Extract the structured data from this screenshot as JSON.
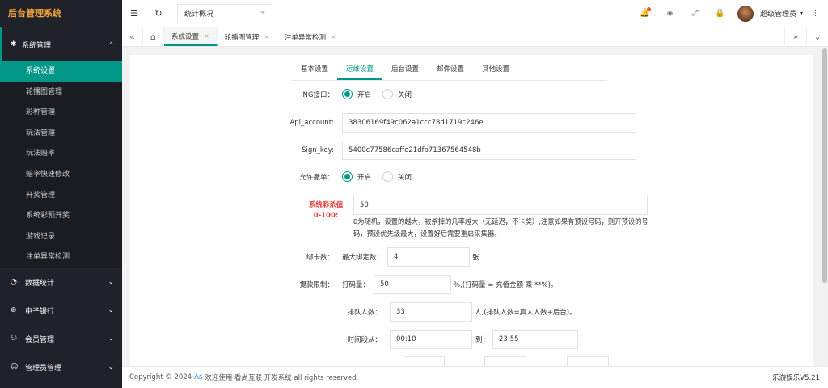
{
  "sidebar": {
    "logo": "后台管理系统",
    "section": "系统管理",
    "items": [
      "系统设置",
      "轮播图管理",
      "彩种管理",
      "玩法管理",
      "玩法赔率",
      "赔率快速修改",
      "开奖管理",
      "系统彩预开奖",
      "游戏记录",
      "注单异常检测"
    ],
    "groups": [
      "数据统计",
      "电子银行",
      "会员管理",
      "管理员管理"
    ]
  },
  "topbar": {
    "select_value": "统计概况",
    "user": "超级管理员"
  },
  "tabs": [
    "系统设置",
    "轮播图管理",
    "注单异常检测"
  ],
  "inner_tabs": [
    "基本设置",
    "运维设置",
    "后台设置",
    "邮件设置",
    "其他设置"
  ],
  "form": {
    "ng_label": "NG接口：",
    "radio_on": "开启",
    "radio_off": "关闭",
    "api_label": "Api_account:",
    "api_value": "38306169f49c062a1ccc78d1719c246e",
    "sign_label": "Sign_key:",
    "sign_value": "5400c77586caffe21dfb71367564548b",
    "cancel_label": "允许撤单：",
    "kill_label_1": "系统彩杀值",
    "kill_label_2": "0-100:",
    "kill_value": "50",
    "kill_help": "0为随机，设置的越大，被杀掉的几率越大（无延迟，不卡奖）,注意如果有预设号码，则开预设的号码，预设优先级最大，设置好后需要重启采集器。",
    "card_label": "绑卡数：",
    "card_sub": "最大绑定数：",
    "card_value": "4",
    "card_unit": "张",
    "withdraw_label": "提款限制：",
    "bet_label": "打码量：",
    "bet_value": "50",
    "bet_note": "%,(打码量 = 充值金额 乘 **%)。",
    "queue_label": "排队人数：",
    "queue_value": "33",
    "queue_note": "人,(排队人数=真人人数+后台)。",
    "time_label": "时间段从：",
    "time_from": "00:10",
    "to_label": "到：",
    "time_to": "23:55"
  },
  "footer": {
    "prefix": "Copyright © 2024",
    "link": "As",
    "text": "欢迎使用 看尚互联 开发系统 all rights reserved.",
    "version": "乐游娱乐V5.21"
  }
}
